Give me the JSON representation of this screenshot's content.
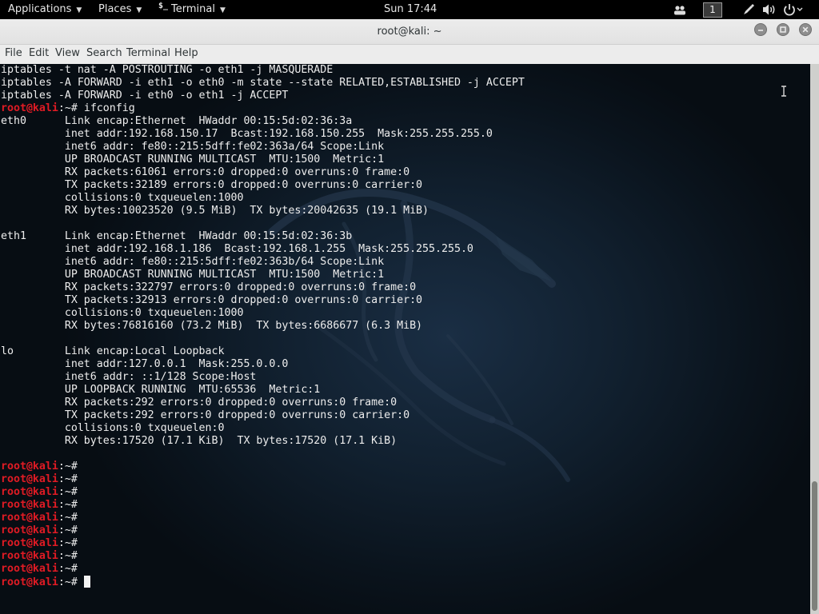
{
  "topbar": {
    "applications_label": "Applications",
    "places_label": "Places",
    "terminal_app_label": "Terminal",
    "terminal_app_glyph": "$_",
    "clock": "Sun 17:44",
    "workspace": "1",
    "icons": [
      "users-icon",
      "pen-icon",
      "volume-icon",
      "power-icon",
      "chevron-down-icon"
    ]
  },
  "window": {
    "title": "root@kali: ~",
    "buttons": [
      "minimize-icon",
      "maximize-icon",
      "close-icon"
    ]
  },
  "menubar": {
    "file": "File",
    "edit": "Edit",
    "view": "View",
    "search": "Search",
    "terminal": "Terminal",
    "help": "Help"
  },
  "terminal": {
    "prompt_user": "root@kali",
    "prompt_suffix": ":~#",
    "lines": [
      {
        "text": "iptables -t nat -A POSTROUTING -o eth1 -j MASQUERADE"
      },
      {
        "text": "iptables -A FORWARD -i eth1 -o eth0 -m state --state RELATED,ESTABLISHED -j ACCEPT"
      },
      {
        "text": "iptables -A FORWARD -i eth0 -o eth1 -j ACCEPT"
      },
      {
        "prompt": true,
        "cmd": " ifconfig"
      },
      {
        "text": "eth0      Link encap:Ethernet  HWaddr 00:15:5d:02:36:3a  "
      },
      {
        "text": "          inet addr:192.168.150.17  Bcast:192.168.150.255  Mask:255.255.255.0"
      },
      {
        "text": "          inet6 addr: fe80::215:5dff:fe02:363a/64 Scope:Link"
      },
      {
        "text": "          UP BROADCAST RUNNING MULTICAST  MTU:1500  Metric:1"
      },
      {
        "text": "          RX packets:61061 errors:0 dropped:0 overruns:0 frame:0"
      },
      {
        "text": "          TX packets:32189 errors:0 dropped:0 overruns:0 carrier:0"
      },
      {
        "text": "          collisions:0 txqueuelen:1000 "
      },
      {
        "text": "          RX bytes:10023520 (9.5 MiB)  TX bytes:20042635 (19.1 MiB)"
      },
      {
        "text": ""
      },
      {
        "text": "eth1      Link encap:Ethernet  HWaddr 00:15:5d:02:36:3b  "
      },
      {
        "text": "          inet addr:192.168.1.186  Bcast:192.168.1.255  Mask:255.255.255.0"
      },
      {
        "text": "          inet6 addr: fe80::215:5dff:fe02:363b/64 Scope:Link"
      },
      {
        "text": "          UP BROADCAST RUNNING MULTICAST  MTU:1500  Metric:1"
      },
      {
        "text": "          RX packets:322797 errors:0 dropped:0 overruns:0 frame:0"
      },
      {
        "text": "          TX packets:32913 errors:0 dropped:0 overruns:0 carrier:0"
      },
      {
        "text": "          collisions:0 txqueuelen:1000 "
      },
      {
        "text": "          RX bytes:76816160 (73.2 MiB)  TX bytes:6686677 (6.3 MiB)"
      },
      {
        "text": ""
      },
      {
        "text": "lo        Link encap:Local Loopback  "
      },
      {
        "text": "          inet addr:127.0.0.1  Mask:255.0.0.0"
      },
      {
        "text": "          inet6 addr: ::1/128 Scope:Host"
      },
      {
        "text": "          UP LOOPBACK RUNNING  MTU:65536  Metric:1"
      },
      {
        "text": "          RX packets:292 errors:0 dropped:0 overruns:0 frame:0"
      },
      {
        "text": "          TX packets:292 errors:0 dropped:0 overruns:0 carrier:0"
      },
      {
        "text": "          collisions:0 txqueuelen:0 "
      },
      {
        "text": "          RX bytes:17520 (17.1 KiB)  TX bytes:17520 (17.1 KiB)"
      },
      {
        "text": ""
      },
      {
        "prompt": true,
        "cmd": " "
      },
      {
        "prompt": true,
        "cmd": " "
      },
      {
        "prompt": true,
        "cmd": " "
      },
      {
        "prompt": true,
        "cmd": " "
      },
      {
        "prompt": true,
        "cmd": " "
      },
      {
        "prompt": true,
        "cmd": " "
      },
      {
        "prompt": true,
        "cmd": " "
      },
      {
        "prompt": true,
        "cmd": " "
      },
      {
        "prompt": true,
        "cmd": " "
      },
      {
        "prompt": true,
        "cmd": " ",
        "cursor": true
      }
    ]
  },
  "colors": {
    "prompt_red": "#e01b24",
    "terminal_fg": "#ededed",
    "terminal_bg": "#0b1722"
  }
}
